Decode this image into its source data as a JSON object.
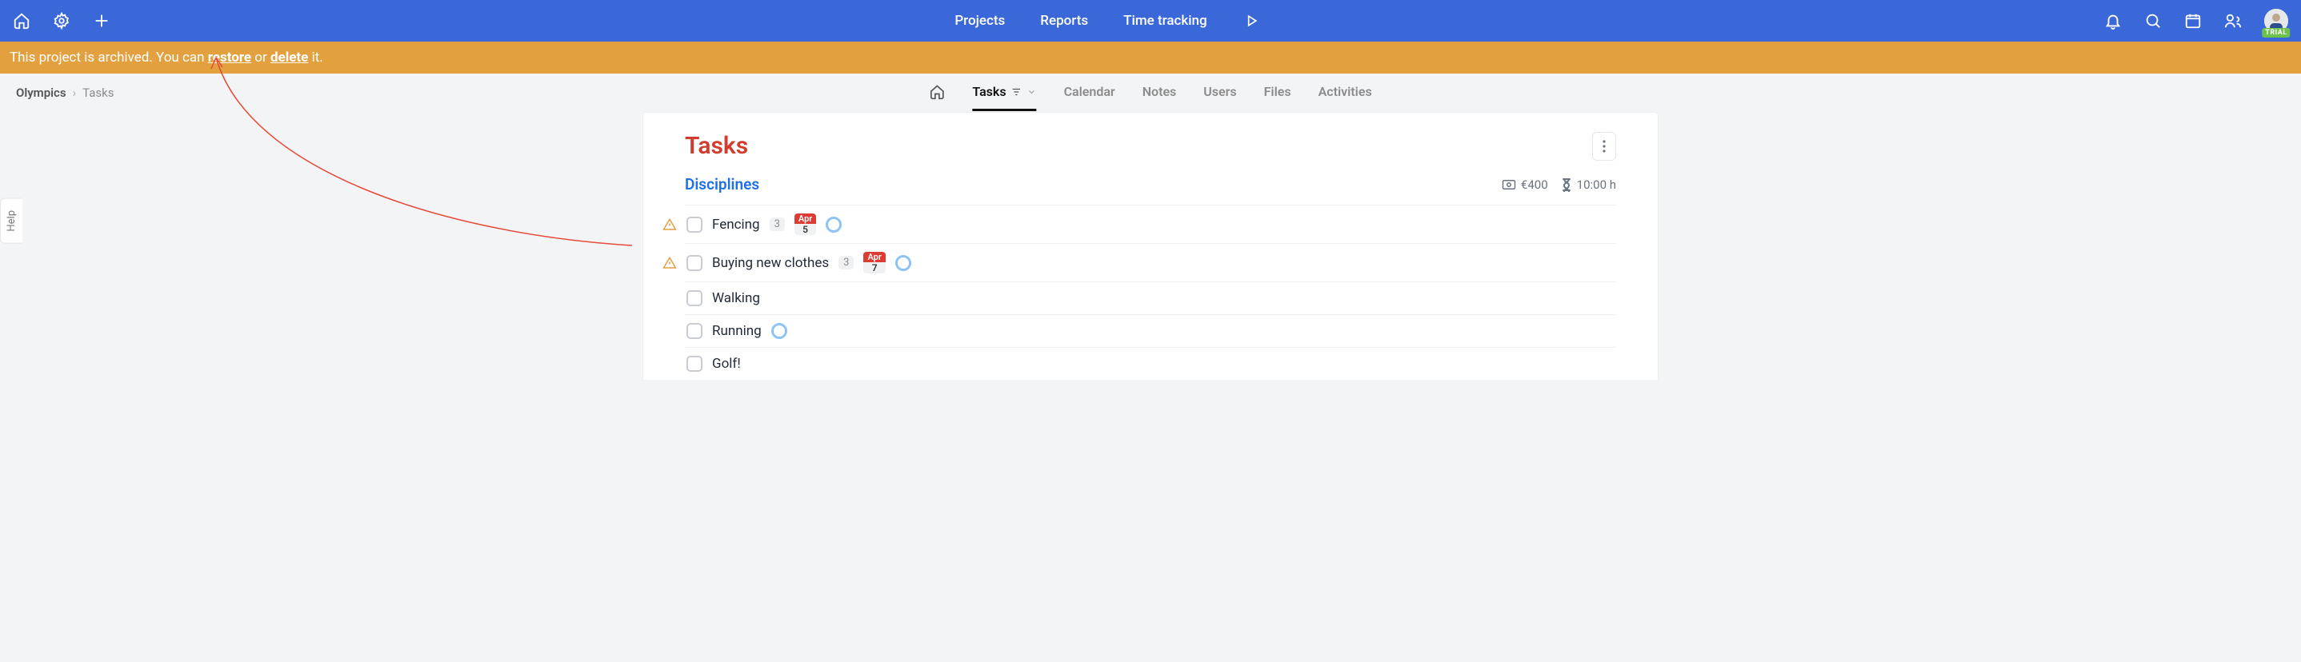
{
  "topbar": {
    "nav": {
      "projects": "Projects",
      "reports": "Reports",
      "time": "Time tracking"
    },
    "badge": "TRIAL"
  },
  "banner": {
    "prefix": "This project is archived. You can ",
    "restore": "restore",
    "or": " or ",
    "delete": "delete",
    "suffix": " it."
  },
  "breadcrumb": {
    "project": "Olympics",
    "section": "Tasks"
  },
  "tabs": {
    "tasks": "Tasks",
    "calendar": "Calendar",
    "notes": "Notes",
    "users": "Users",
    "files": "Files",
    "activities": "Activities"
  },
  "help": "Help",
  "page": {
    "title": "Tasks",
    "group": {
      "title": "Disciplines",
      "budget": "€400",
      "time": "10:00 h"
    },
    "tasks": [
      {
        "warn": true,
        "name": "Fencing",
        "sub": "3",
        "date": {
          "m": "Apr",
          "d": "5"
        },
        "assignee": true
      },
      {
        "warn": true,
        "name": "Buying new clothes",
        "sub": "3",
        "date": {
          "m": "Apr",
          "d": "7"
        },
        "assignee": true
      },
      {
        "warn": false,
        "name": "Walking",
        "sub": null,
        "date": null,
        "assignee": false
      },
      {
        "warn": false,
        "name": "Running",
        "sub": null,
        "date": null,
        "assignee": true
      },
      {
        "warn": false,
        "name": "Golf!",
        "sub": null,
        "date": null,
        "assignee": false
      }
    ]
  }
}
